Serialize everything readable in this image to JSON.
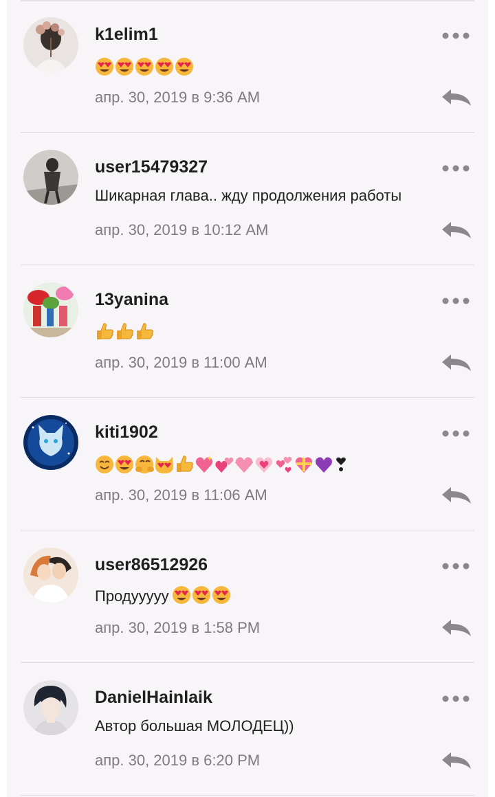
{
  "comments": [
    {
      "username": "k1elim1",
      "text": "",
      "emojis": [
        "heart-eyes",
        "heart-eyes",
        "heart-eyes",
        "heart-eyes",
        "heart-eyes"
      ],
      "timestamp": "апр. 30, 2019 в 9:36 AM"
    },
    {
      "username": "user15479327",
      "text": "Шикарная глава.. жду продолжения работы",
      "emojis": [],
      "timestamp": "апр. 30, 2019 в 10:12 AM"
    },
    {
      "username": "13yanina",
      "text": "",
      "emojis": [
        "thumbs-up",
        "thumbs-up",
        "thumbs-up"
      ],
      "timestamp": "апр. 30, 2019 в 11:00 AM"
    },
    {
      "username": "kiti1902",
      "text": "",
      "emojis": [
        "smile",
        "heart-eyes",
        "hug",
        "cat-heart-eyes",
        "thumbs-up",
        "sparkling-heart",
        "two-hearts",
        "pink-heart",
        "growing-heart",
        "revolving-hearts",
        "gift-heart",
        "purple-heart",
        "heart-exclamation"
      ],
      "timestamp": "апр. 30, 2019 в 11:06 AM"
    },
    {
      "username": "user86512926",
      "text": "Продууууу",
      "emojis": [
        "heart-eyes",
        "heart-eyes",
        "heart-eyes"
      ],
      "timestamp": "апр. 30, 2019 в 1:58 PM"
    },
    {
      "username": "DanielHainlaik",
      "text": "Автор большая МОЛОДЕЦ))",
      "emojis": [],
      "timestamp": "апр. 30, 2019 в 6:20 PM"
    }
  ],
  "icons": {
    "more": "more-horizontal-icon",
    "reply": "reply-arrow-icon"
  },
  "colors": {
    "background": "#f7f5f8",
    "username": "#1f1f1f",
    "timestamp": "#7d7b80",
    "icon": "#8a888d",
    "divider": "#dddbe0"
  }
}
